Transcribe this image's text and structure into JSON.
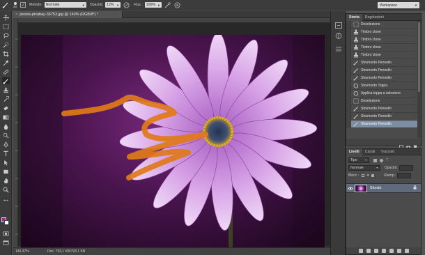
{
  "options_bar": {
    "brush_size": "30",
    "metodo_label": "Metodo:",
    "metodo_value": "Normale",
    "opacita_label": "Opacità:",
    "opacita_value": "12%",
    "flusso_label": "Flus.:",
    "flusso_value": "100%",
    "workspace_value": "Workspace"
  },
  "document": {
    "tab_title": "pexels-pixabay-36753.jpg @ 140% (RGB/8*) *",
    "tab_close": "×",
    "status_zoom": "140,47%",
    "status_doc": "Doc: 793,1 KB/793,1 KB",
    "brush_stroke_color": "#e07a1a"
  },
  "toolbox": {
    "foreground_color": "#b5199c",
    "background_color": "#ffffff",
    "tools": [
      "move-tool-icon",
      "marquee-tool-icon",
      "lasso-tool-icon",
      "quick-select-tool-icon",
      "crop-tool-icon",
      "eyedropper-tool-icon",
      "healing-tool-icon",
      "brush-tool-icon",
      "clone-stamp-tool-icon",
      "history-brush-tool-icon",
      "eraser-tool-icon",
      "gradient-tool-icon",
      "blur-tool-icon",
      "dodge-tool-icon",
      "pen-tool-icon",
      "type-tool-icon",
      "path-select-tool-icon",
      "shape-tool-icon",
      "hand-tool-icon",
      "zoom-tool-icon"
    ]
  },
  "history": {
    "tabs": [
      "Storia",
      "Regolazioni"
    ],
    "items": [
      {
        "label": "Deselezione",
        "icon": "deselect-icon"
      },
      {
        "label": "Timbro clone",
        "icon": "clone-stamp-icon"
      },
      {
        "label": "Timbro clone",
        "icon": "clone-stamp-icon"
      },
      {
        "label": "Timbro clone",
        "icon": "clone-stamp-icon"
      },
      {
        "label": "Timbro clone",
        "icon": "clone-stamp-icon"
      },
      {
        "label": "Strumento Pennello",
        "icon": "brush-icon"
      },
      {
        "label": "Strumento Pennello",
        "icon": "brush-icon"
      },
      {
        "label": "Strumento Pennello",
        "icon": "brush-icon"
      },
      {
        "label": "Strumento Toppa",
        "icon": "patch-icon"
      },
      {
        "label": "Applica toppa a selezione",
        "icon": "patch-icon"
      },
      {
        "label": "Deselezione",
        "icon": "deselect-icon"
      },
      {
        "label": "Strumento Pennello",
        "icon": "brush-icon"
      },
      {
        "label": "Strumento Pennello",
        "icon": "brush-icon"
      },
      {
        "label": "Strumento Pennello",
        "icon": "brush-icon"
      }
    ],
    "selected_index": 13
  },
  "layers": {
    "tabs": [
      "Livelli",
      "Canali",
      "Tracciati"
    ],
    "filter_value": "Tipo",
    "blend_value": "Normale",
    "opacity_label": "Opacità:",
    "lock_label": "Blocc.:",
    "fill_label": "Riemp.:",
    "layer_name": "Sfondo"
  }
}
